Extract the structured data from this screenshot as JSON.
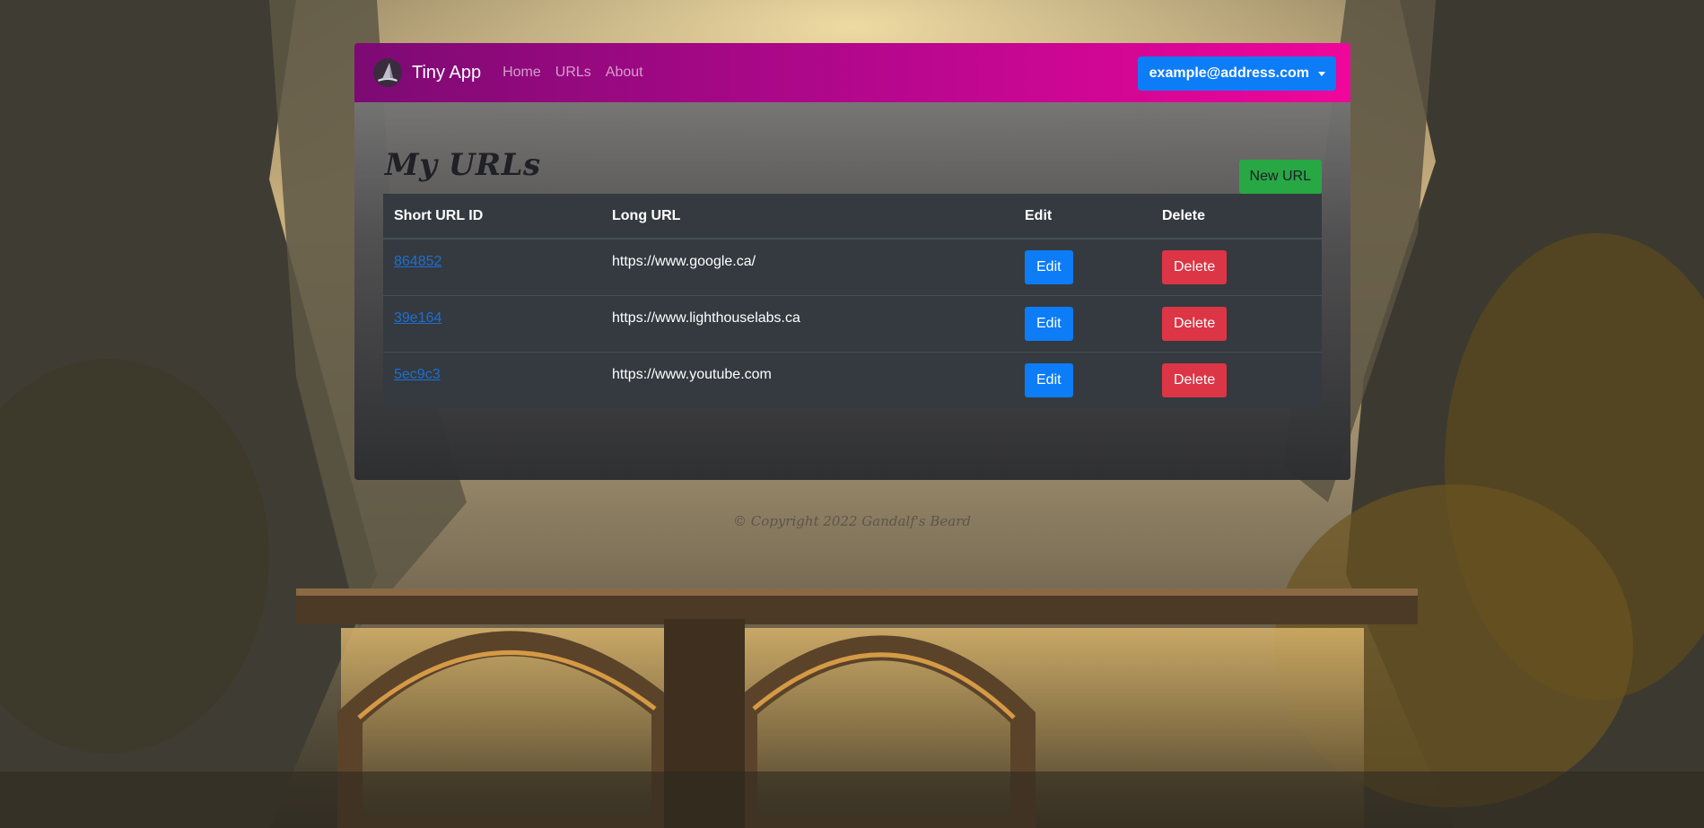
{
  "app": {
    "brand": "Tiny App",
    "brand_logo_icon": "wizard-hat-icon"
  },
  "nav": {
    "links": [
      "Home",
      "URLs",
      "About"
    ]
  },
  "user": {
    "email": "example@address.com"
  },
  "page": {
    "title": "My URLs",
    "new_url_label": "New URL"
  },
  "table": {
    "headers": [
      "Short URL ID",
      "Long URL",
      "Edit",
      "Delete"
    ],
    "rows": [
      {
        "short_id": "864852",
        "long_url": "https://www.google.ca/",
        "edit": "Edit",
        "delete": "Delete"
      },
      {
        "short_id": "39e164",
        "long_url": "https://www.lighthouselabs.ca",
        "edit": "Edit",
        "delete": "Delete"
      },
      {
        "short_id": "5ec9c3",
        "long_url": "https://www.youtube.com",
        "edit": "Edit",
        "delete": "Delete"
      }
    ]
  },
  "footer": {
    "text": "© Copyright 2022 Gandalf's Beard"
  },
  "colors": {
    "navbar_start": "#7d0a74",
    "navbar_end": "#f0069b",
    "primary": "#0d7cf7",
    "success": "#28a745",
    "danger": "#dc3545",
    "table_bg": "#343a40"
  }
}
